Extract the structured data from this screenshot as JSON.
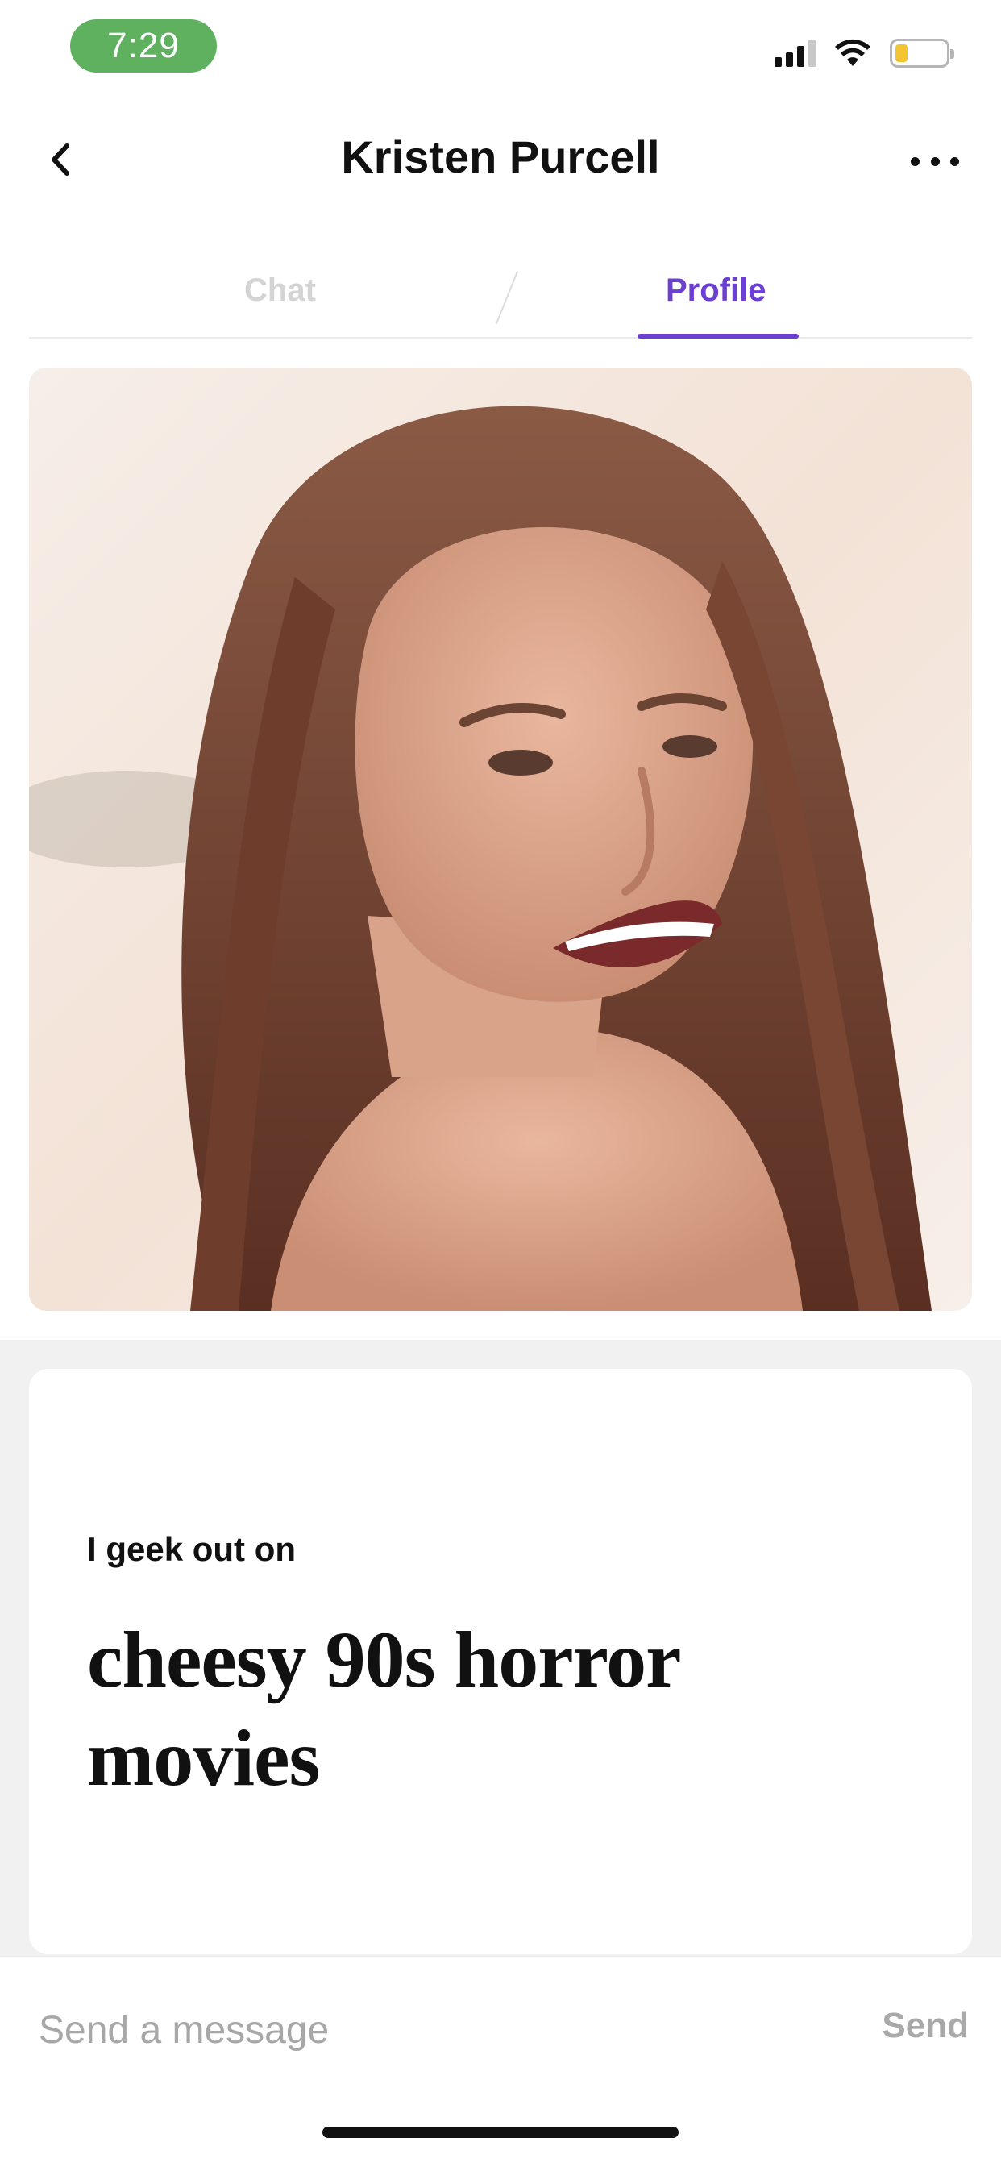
{
  "status_bar": {
    "time": "7:29",
    "time_pill_color": "#5fb15f",
    "battery_color": "#f5c531",
    "icons": [
      "signal-icon",
      "wifi-icon",
      "battery-icon"
    ]
  },
  "header": {
    "title": "Kristen Purcell",
    "back_icon": "chevron-left-icon",
    "more_icon": "ellipsis-icon"
  },
  "tabs": [
    {
      "label": "Chat",
      "active": false
    },
    {
      "label": "Profile",
      "active": true
    }
  ],
  "accent_color": "#6a3fd1",
  "profile": {
    "photo": "profile-photo",
    "prompt": {
      "label": "I geek out on",
      "answer": "cheesy 90s horror movies"
    }
  },
  "composer": {
    "placeholder": "Send a message",
    "send_label": "Send"
  }
}
